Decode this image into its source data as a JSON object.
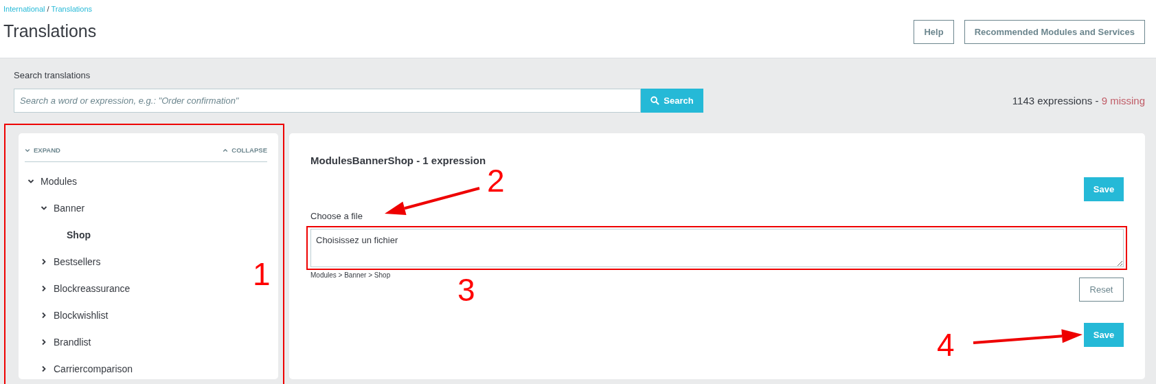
{
  "breadcrumb": [
    {
      "label": "International"
    },
    {
      "label": "Translations"
    }
  ],
  "breadcrumb_separator": "/",
  "title": "Translations",
  "header_buttons": [
    "Help",
    "Recommended Modules and Services"
  ],
  "search": {
    "label": "Search translations",
    "placeholder": "Search a word or expression, e.g.: \"Order confirmation\"",
    "button": "Search"
  },
  "summary": {
    "total": "1143 expressions",
    "separator": "-",
    "missing": "9 missing"
  },
  "tree": {
    "expand": "EXPAND",
    "collapse": "COLLAPSE",
    "items": [
      {
        "label": "Modules",
        "expanded": true,
        "selected": false,
        "children": [
          {
            "label": "Banner",
            "expanded": true,
            "selected": false,
            "children": [
              {
                "label": "Shop",
                "selected": true
              }
            ]
          },
          {
            "label": "Bestsellers",
            "expanded": false,
            "selected": false
          },
          {
            "label": "Blockreassurance",
            "expanded": false,
            "selected": false
          },
          {
            "label": "Blockwishlist",
            "expanded": false,
            "selected": false
          },
          {
            "label": "Brandlist",
            "expanded": false,
            "selected": false
          },
          {
            "label": "Carriercomparison",
            "expanded": false,
            "selected": false
          }
        ]
      }
    ]
  },
  "editor": {
    "title": "ModulesBannerShop - 1 expression",
    "save_top": "Save",
    "field_label": "Choose a file",
    "value": "Choisissez un fichier",
    "path": "Modules > Banner > Shop",
    "reset": "Reset",
    "save_bottom": "Save"
  },
  "annotations": [
    {
      "kind": "box"
    },
    {
      "kind": "number",
      "text": "1"
    },
    {
      "kind": "arrow"
    },
    {
      "kind": "number",
      "text": "2"
    },
    {
      "kind": "box"
    },
    {
      "kind": "number",
      "text": "3"
    },
    {
      "kind": "arrow"
    },
    {
      "kind": "number",
      "text": "4"
    }
  ]
}
